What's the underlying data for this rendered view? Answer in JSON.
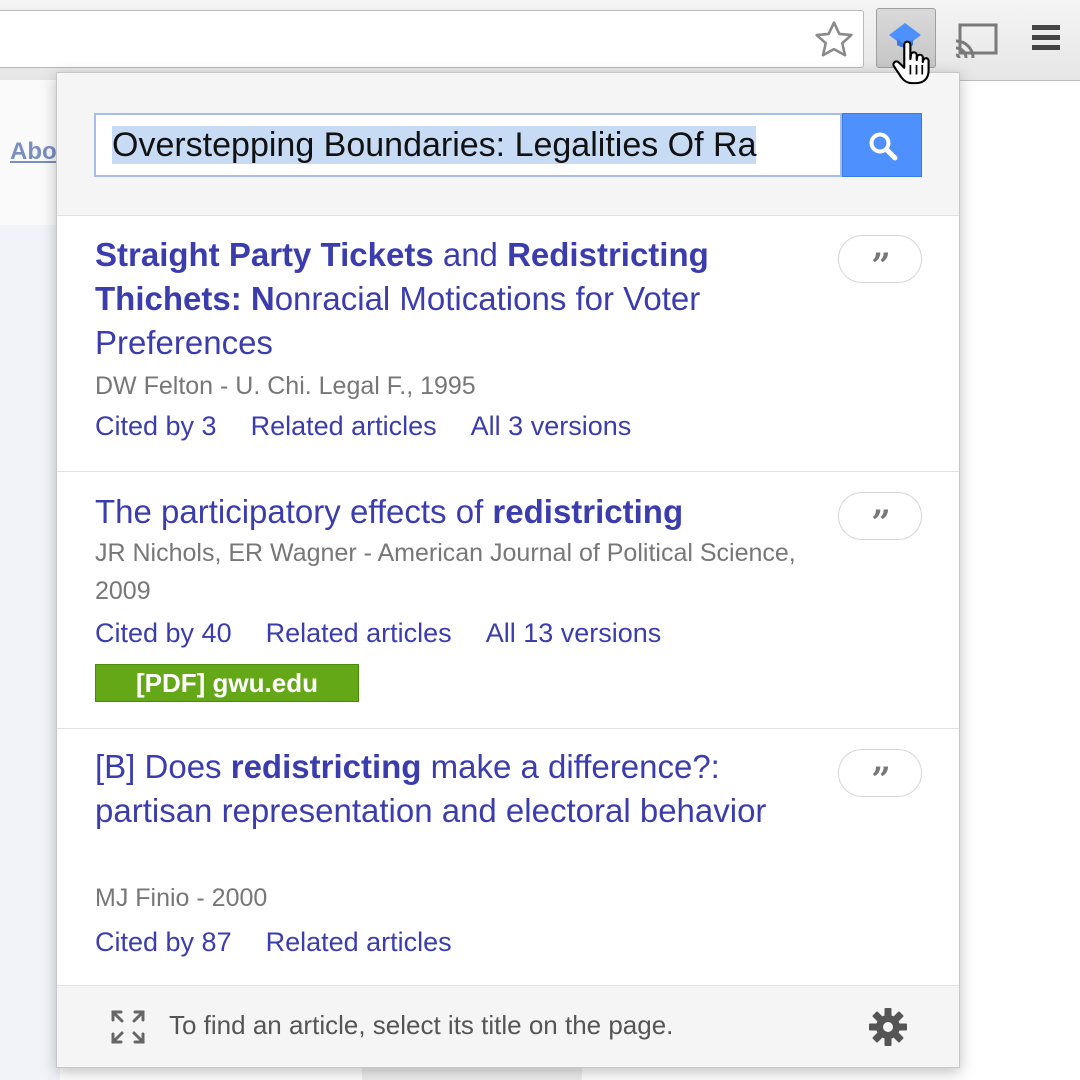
{
  "page": {
    "link_fragment": "Abo"
  },
  "toolbar": {
    "icons": [
      "star-icon",
      "scholar-extension-icon",
      "cursor-hand-icon",
      "cast-icon",
      "menu-icon"
    ]
  },
  "popup": {
    "search": {
      "value": "Overstepping Boundaries: Legalities Of Ra",
      "button_icon": "search-icon"
    },
    "results": [
      {
        "title_parts": [
          {
            "text": "Straight Party Tickets",
            "bold": true
          },
          {
            "text": " and ",
            "bold": false
          },
          {
            "text": "Redistricting",
            "bold": true
          },
          {
            "text": " ",
            "bold": false
          },
          {
            "text": "Thichets: N",
            "bold": true
          },
          {
            "text": "onracial Motications for Voter Preferences",
            "bold": false
          }
        ],
        "meta": "DW Felton - U. Chi. Legal F., 1995",
        "links": [
          "Cited by 3",
          "Related articles",
          "All 3 versions"
        ]
      },
      {
        "title_parts": [
          {
            "text": "The participatory effects of ",
            "bold": false
          },
          {
            "text": "redistricting",
            "bold": true
          }
        ],
        "meta": "JR Nichols, ER Wagner - American Journal of Political Science, 2009",
        "links": [
          "Cited by 40",
          "Related articles",
          "All 13 versions"
        ],
        "pdf": "[PDF] gwu.edu"
      },
      {
        "title_parts": [
          {
            "text": "[B] Does ",
            "bold": false
          },
          {
            "text": "redistricting",
            "bold": true
          },
          {
            "text": " make a difference?: partisan representation and electoral behavior",
            "bold": false
          }
        ],
        "meta": "MJ Finio - 2000",
        "links": [
          "Cited by 87",
          "Related articles"
        ]
      }
    ],
    "quote_symbol": "”",
    "footer": {
      "text": "To find an article, select its title on the page.",
      "icons": [
        "expand-icon",
        "gear-icon"
      ]
    }
  },
  "colors": {
    "link": "#3b3dae",
    "accent": "#4d90fe",
    "pdf_badge": "#64a817",
    "meta_text": "#777777"
  }
}
